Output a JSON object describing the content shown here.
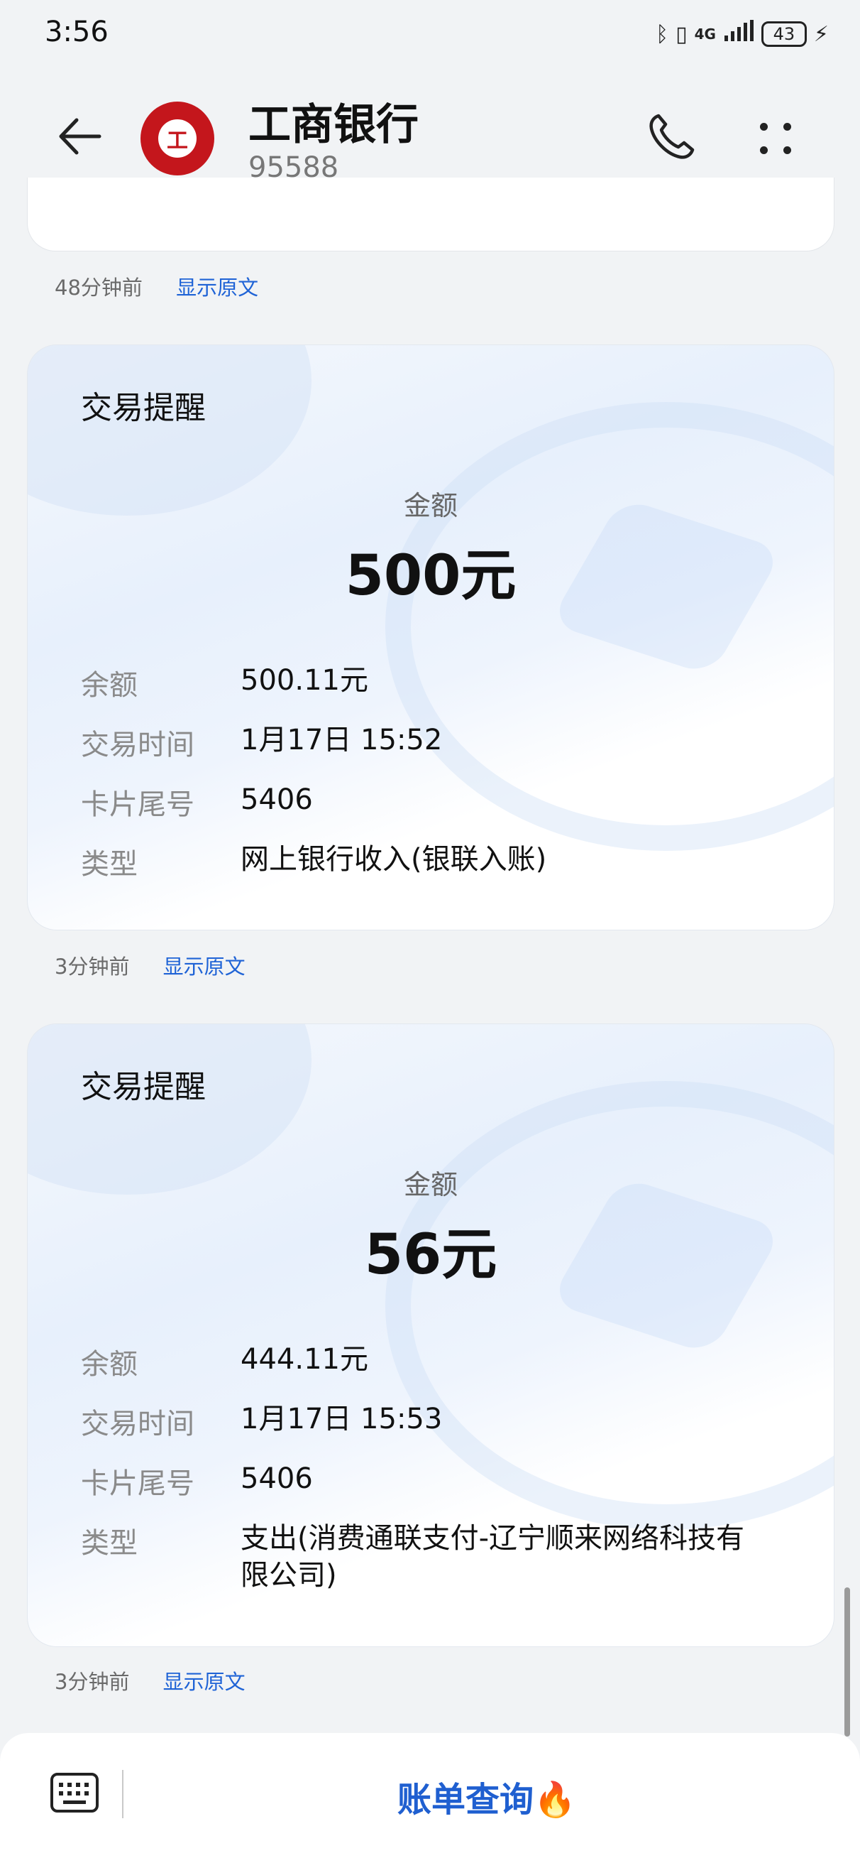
{
  "status_bar": {
    "time": "3:56",
    "network": "4G",
    "battery": "43",
    "icons": [
      "bluetooth-icon",
      "vibrate-icon",
      "signal-icon",
      "battery-icon",
      "charging-icon"
    ]
  },
  "header": {
    "title": "工商银行",
    "number": "95588",
    "logo_glyph": "工"
  },
  "messages": [
    {
      "time": "48分钟前",
      "action": "显示原文"
    },
    {
      "card_title": "交易提醒",
      "amount_label": "金额",
      "amount": "500元",
      "rows": [
        {
          "label": "余额",
          "value": "500.11元"
        },
        {
          "label": "交易时间",
          "value": "1月17日 15:52"
        },
        {
          "label": "卡片尾号",
          "value": "5406"
        },
        {
          "label": "类型",
          "value": "网上银行收入(银联入账)"
        }
      ],
      "time": "3分钟前",
      "action": "显示原文"
    },
    {
      "card_title": "交易提醒",
      "amount_label": "金额",
      "amount": "56元",
      "rows": [
        {
          "label": "余额",
          "value": "444.11元"
        },
        {
          "label": "交易时间",
          "value": "1月17日 15:53"
        },
        {
          "label": "卡片尾号",
          "value": "5406"
        },
        {
          "label": "类型",
          "value": "支出(消费通联支付-辽宁顺来网络科技有限公司)"
        }
      ],
      "time": "3分钟前",
      "action": "显示原文"
    }
  ],
  "bottom_bar": {
    "menu_label": "账单查询🔥"
  },
  "colors": {
    "accent": "#1f5fd0",
    "link": "#1f63d6",
    "brand_red": "#c4161c"
  }
}
